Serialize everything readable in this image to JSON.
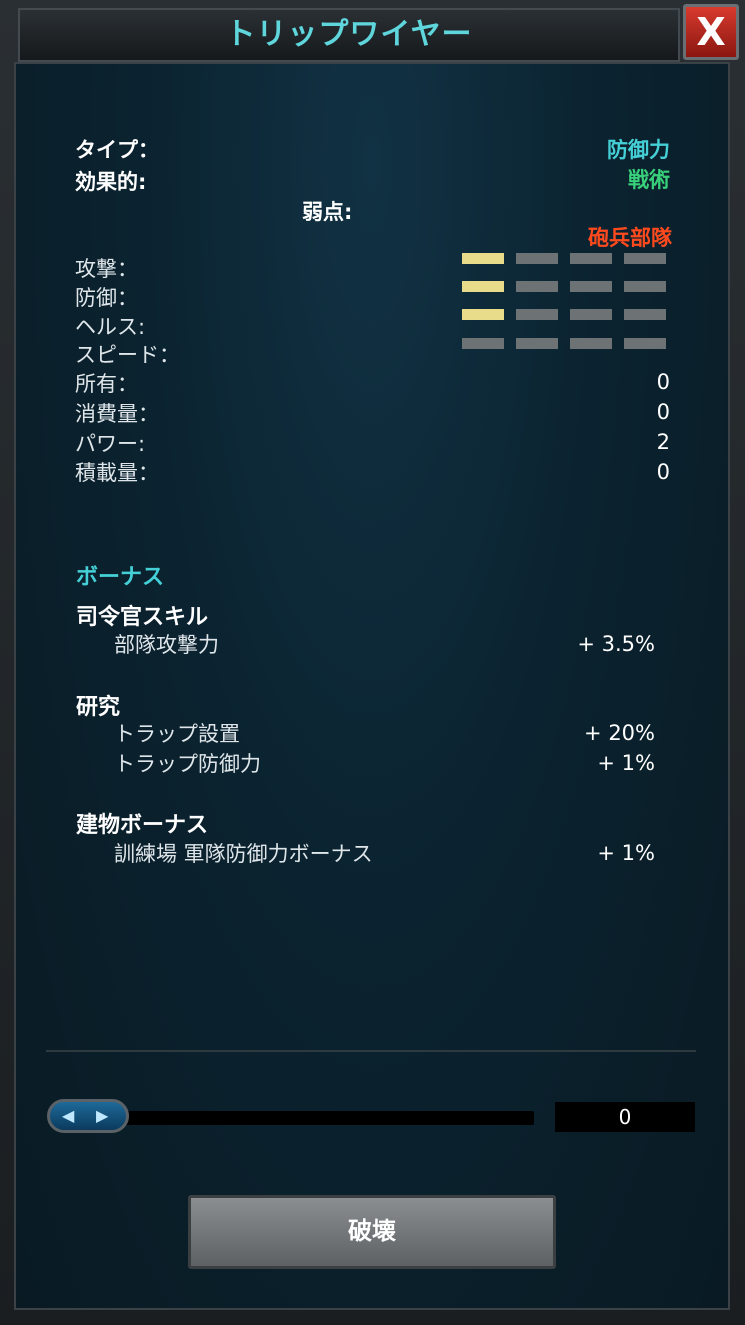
{
  "header": {
    "title": "トリップワイヤー",
    "close_label": "X"
  },
  "stats": {
    "type_label": "タイプ：",
    "type_value": "防御力",
    "effective_label": "効果的:",
    "effective_value": "戦術",
    "weak_label": "弱点:",
    "weak_value": "砲兵部隊",
    "attack_label": "攻撃：",
    "defense_label": "防御：",
    "health_label": "ヘルス:",
    "speed_label": "スピード：",
    "owned_label": "所有：",
    "owned_value": "0",
    "upkeep_label": "消費量：",
    "upkeep_value": "0",
    "power_label": "パワー:",
    "power_value": "2",
    "load_label": "積載量：",
    "load_value": "0",
    "ratings": {
      "attack": 1,
      "defense": 1,
      "health": 1,
      "speed": 0,
      "max": 4
    }
  },
  "bonus": {
    "heading": "ボーナス",
    "commander_heading": "司令官スキル",
    "commander_item": "部隊攻撃力",
    "commander_value": "+ 3.5%",
    "research_heading": "研究",
    "research_item1": "トラップ設置",
    "research_value1": "+ 20%",
    "research_item2": "トラップ防御力",
    "research_value2": "+ 1%",
    "building_heading": "建物ボーナス",
    "building_item": "訓練場 軍隊防御力ボーナス",
    "building_value": "+ 1%"
  },
  "controls": {
    "quantity_value": "0",
    "destroy_label": "破壊"
  },
  "colors": {
    "accent_cyan": "#44d0d6",
    "effective_green": "#38d07a",
    "weak_red": "#ff4a1e",
    "bar_on": "#e8dc8a",
    "bar_off": "#6d7274",
    "close_red": "#c62d22"
  }
}
